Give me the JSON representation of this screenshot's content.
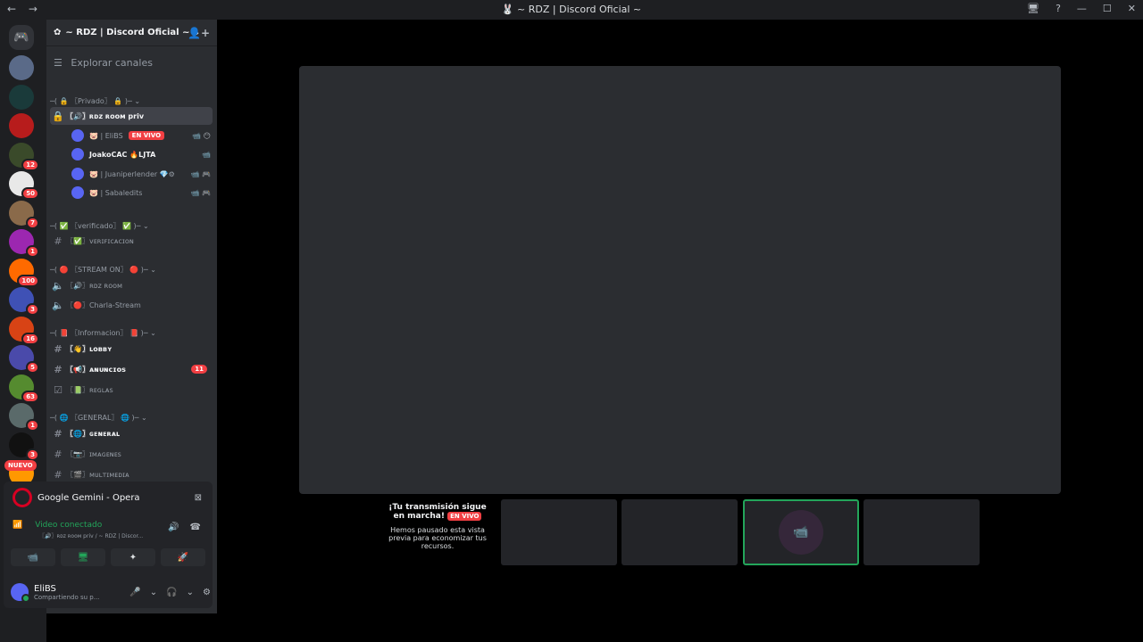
{
  "window": {
    "back": "←",
    "forward": "→",
    "title": "🐰 ~ RDZ | Discord Oficial ~",
    "controls": [
      "🖥",
      "?",
      "—",
      "☐",
      "✕"
    ]
  },
  "rail": {
    "home_icon": "discord-icon",
    "home_glyph": "🎮",
    "nuevo": "NUEVO",
    "servers": [
      {
        "name": "server-1",
        "badge": null,
        "color": "#5a6a88"
      },
      {
        "name": "server-2",
        "badge": null,
        "color": "#1a3a3a"
      },
      {
        "name": "server-3",
        "badge": null,
        "color": "#b71c1c"
      },
      {
        "name": "server-4",
        "badge": "12",
        "color": "#3a4a2a"
      },
      {
        "name": "server-5",
        "badge": "50",
        "color": "#e8e8e8"
      },
      {
        "name": "server-6",
        "badge": "7",
        "color": "#8a6a4a"
      },
      {
        "name": "server-7",
        "badge": "1",
        "color": "#9c27b0"
      },
      {
        "name": "server-8",
        "badge": "100",
        "color": "#ff6a00"
      },
      {
        "name": "server-9",
        "badge": "3",
        "color": "#3f51b5"
      },
      {
        "name": "server-10",
        "badge": "16",
        "color": "#d84315"
      },
      {
        "name": "server-11",
        "badge": "5",
        "color": "#4a4aaa"
      },
      {
        "name": "server-12",
        "badge": "63",
        "color": "#558b2f"
      },
      {
        "name": "server-13",
        "badge": "1",
        "color": "#5a6a6a"
      },
      {
        "name": "server-14",
        "badge": "3",
        "color": "#111111"
      },
      {
        "name": "server-15",
        "badge": null,
        "color": "#ff9800"
      }
    ]
  },
  "sidebar": {
    "server_name": "~ RDZ | Discord Oficial ~",
    "explore": "Explorar canales",
    "rows": [
      {
        "type": "cat",
        "text": "─( 🔒 〖Privado〗 🔒 )─ ⌄",
        "icon": ""
      },
      {
        "type": "sel",
        "text": "〖🔊〗ʀᴅᴢ ʀᴏᴏᴍ priv",
        "icon": "🔒"
      },
      {
        "type": "cat",
        "text": "─( ✅ 〖verificado〗 ✅ )─ ⌄",
        "icon": ""
      },
      {
        "type": "ch",
        "text": "〖✅〗ᴠᴇʀɪꜰɪᴄᴀᴄɪᴏɴ",
        "icon": "#"
      },
      {
        "type": "cat",
        "text": "─( 🔴 〖STREAM ON〗 🔴 )─ ⌄",
        "icon": ""
      },
      {
        "type": "ch",
        "text": "〖🔊〗ʀᴅᴢ ʀᴏᴏᴍ",
        "icon": "🔈"
      },
      {
        "type": "ch",
        "text": "〖🔴〗Charla-Stream",
        "icon": "🔈"
      },
      {
        "type": "cat",
        "text": "─( 📕 〖Informacion〗 📕 )─ ⌄",
        "icon": ""
      },
      {
        "type": "bright",
        "text": "〖👋〗ʟᴏʙʙʏ",
        "icon": "#"
      },
      {
        "type": "bright",
        "text": "〖📢〗ᴀɴᴜɴᴄɪᴏꜱ",
        "icon": "#",
        "count": "11"
      },
      {
        "type": "ch",
        "text": "〖📗〗ʀᴇɢʟᴀꜱ",
        "icon": "☑"
      },
      {
        "type": "cat",
        "text": "─( 🌐 〖GENERAL〗 🌐 )─ ⌄",
        "icon": ""
      },
      {
        "type": "bright",
        "text": "〖🌐〗ɢᴇɴᴇʀᴀʟ",
        "icon": "#"
      },
      {
        "type": "ch",
        "text": "〖📷〗ɪᴍᴀɢᴇɴᴇꜱ",
        "icon": "#"
      },
      {
        "type": "ch",
        "text": "〖🎬〗ᴍᴜʟᴛɪᴍᴇᴅɪᴀ",
        "icon": "#"
      }
    ],
    "voice_users": [
      {
        "name": "🐷 | EliBS",
        "live": "EN VIVO",
        "icons": "📹 😶",
        "white": false
      },
      {
        "name": "JoakoCAC 🔥LJTA",
        "live": null,
        "icons": "📹",
        "white": true
      },
      {
        "name": "🐷 | Juaniperlender 💎⚙",
        "live": null,
        "icons": "📹 🎮",
        "white": false
      },
      {
        "name": "🐷 | Sabaledits",
        "live": null,
        "icons": "📹 🎮",
        "white": false
      }
    ]
  },
  "activity": {
    "app": "Google Gemini - Opera",
    "close": "⊠"
  },
  "voice": {
    "status": "Video conectado",
    "channel": "〖🔊〗ʀᴅᴢ ʀᴏᴏᴍ priv / ~ RDZ | Discor...",
    "icons": [
      "🔊",
      "☎"
    ],
    "buttons": [
      "📹",
      "🖥",
      "✦",
      "🚀"
    ]
  },
  "user": {
    "name": "EliBS",
    "status": "Compartiendo su p...",
    "controls": [
      "🎤",
      "⌄",
      "🎧",
      "⌄",
      "⚙"
    ]
  },
  "stream": {
    "heading": "¡Tu transmisión sigue en marcha!",
    "live": "EN VIVO",
    "message": "Hemos pausado esta vista previa para economizar tus recursos.",
    "cam_icon": "📹"
  }
}
